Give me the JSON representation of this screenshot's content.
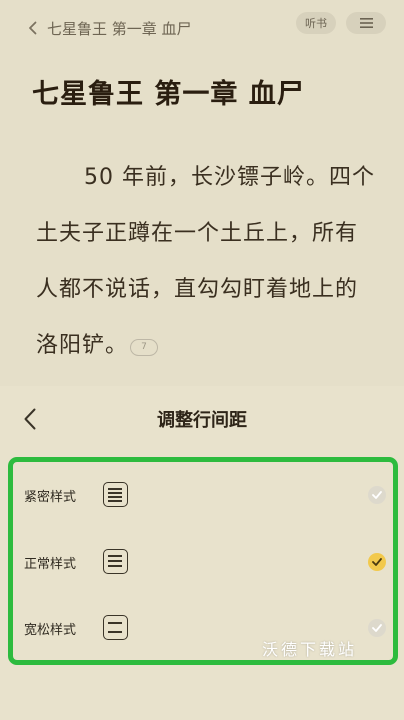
{
  "header": {
    "back_title": "七星鲁王 第一章 血尸",
    "listen_label": "听书",
    "menu_icon": "hamburger-icon"
  },
  "chapter": {
    "title": "七星鲁王 第一章 血尸",
    "paragraph": "50 年前，长沙镖子岭。四个土夫子正蹲在一个土丘上，所有人都不说话，直勾勾盯着地上的洛阳铲。",
    "comment_count": "7"
  },
  "panel": {
    "title": "调整行间距",
    "options": [
      {
        "label": "紧密样式",
        "icon": "compact-lines-icon",
        "selected": false
      },
      {
        "label": "正常样式",
        "icon": "normal-lines-icon",
        "selected": true
      },
      {
        "label": "宽松样式",
        "icon": "loose-lines-icon",
        "selected": false
      }
    ]
  },
  "colors": {
    "background": "#e5dfc9",
    "highlight_border": "#2dbb3e",
    "selected_check": "#f2c94c"
  },
  "watermark": "沃德下载站"
}
